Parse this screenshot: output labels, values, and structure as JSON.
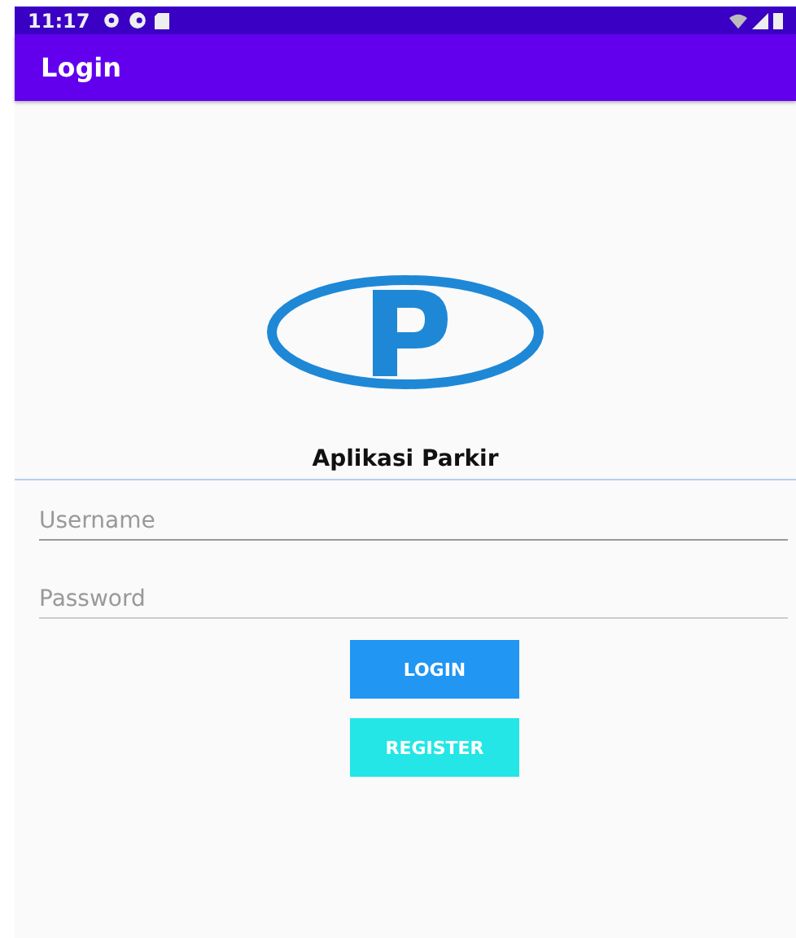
{
  "status_bar": {
    "time": "11:17"
  },
  "app_bar": {
    "title": "Login"
  },
  "logo": {
    "caption": "Aplikasi Parkir"
  },
  "fields": [
    {
      "placeholder": "Username"
    },
    {
      "placeholder": "Password"
    }
  ],
  "buttons": [
    {
      "label": "LOGIN",
      "kind": "primary"
    },
    {
      "label": "REGISTER",
      "kind": "secondary"
    }
  ]
}
